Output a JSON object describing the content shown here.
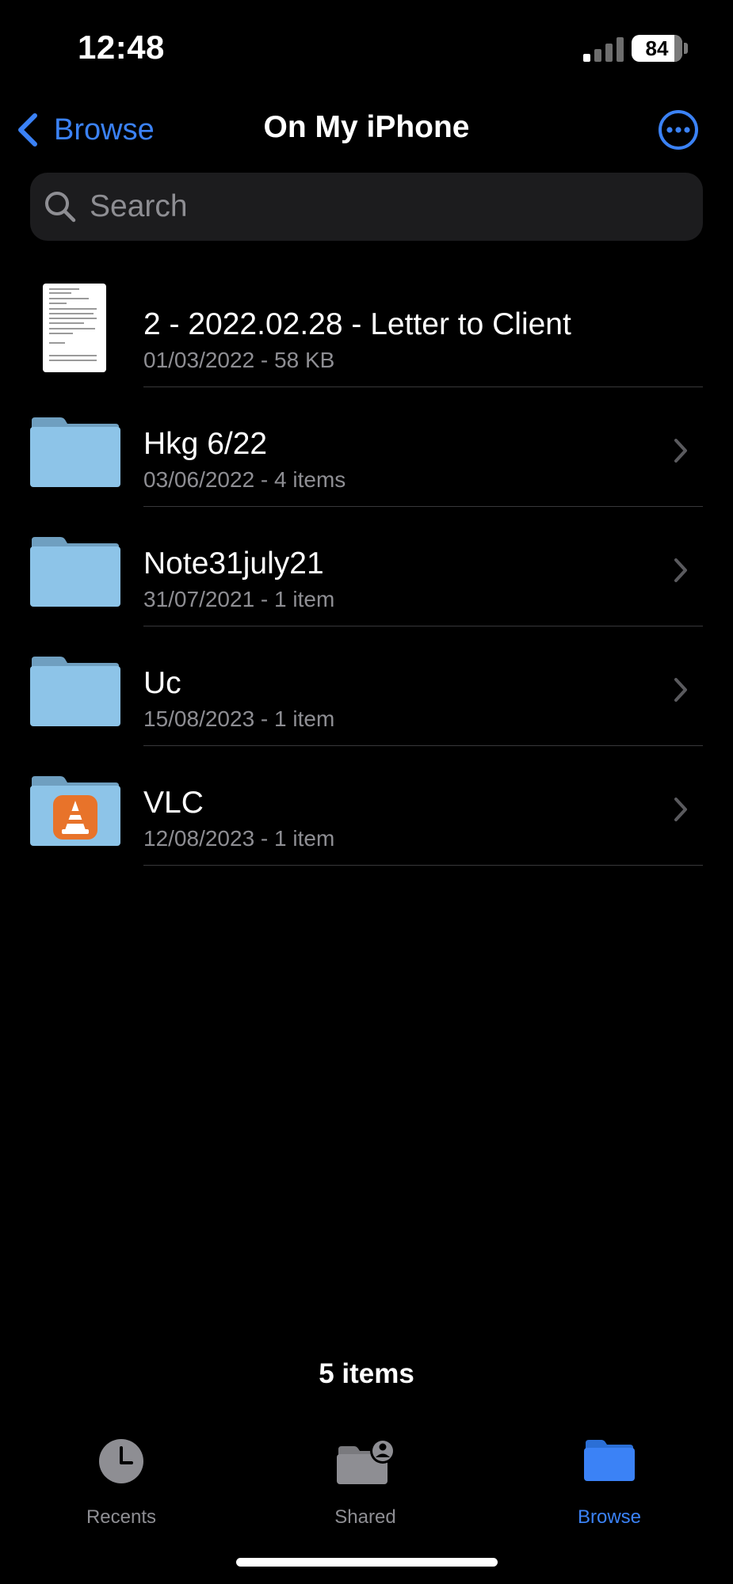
{
  "status_bar": {
    "time": "12:48",
    "battery": "84"
  },
  "nav": {
    "back_label": "Browse",
    "title": "On My iPhone",
    "more_icon": "ellipsis-circle-icon"
  },
  "search": {
    "placeholder": "Search",
    "value": ""
  },
  "files": [
    {
      "name": "2 - 2022.02.28 - Letter to Client",
      "meta": "01/03/2022 - 58 KB",
      "kind": "document"
    },
    {
      "name": "Hkg 6/22",
      "meta": "03/06/2022 - 4 items",
      "kind": "folder"
    },
    {
      "name": "Note31july21",
      "meta": "31/07/2021 - 1 item",
      "kind": "folder"
    },
    {
      "name": "Uc",
      "meta": "15/08/2023 - 1 item",
      "kind": "folder"
    },
    {
      "name": "VLC",
      "meta": "12/08/2023 - 1 item",
      "kind": "folder-app"
    }
  ],
  "item_count": "5 items",
  "tab_bar": {
    "tabs": [
      {
        "label": "Recents",
        "icon": "clock-icon",
        "active": false
      },
      {
        "label": "Shared",
        "icon": "shared-folder-icon",
        "active": false
      },
      {
        "label": "Browse",
        "icon": "folder-icon",
        "active": true
      }
    ]
  },
  "colors": {
    "accent": "#3b82f6",
    "background": "#000000",
    "secondary_text": "#8e8e93",
    "search_bg": "#1c1c1e",
    "folder": "#8dc4e8",
    "inactive_tab": "#8e8e93"
  }
}
